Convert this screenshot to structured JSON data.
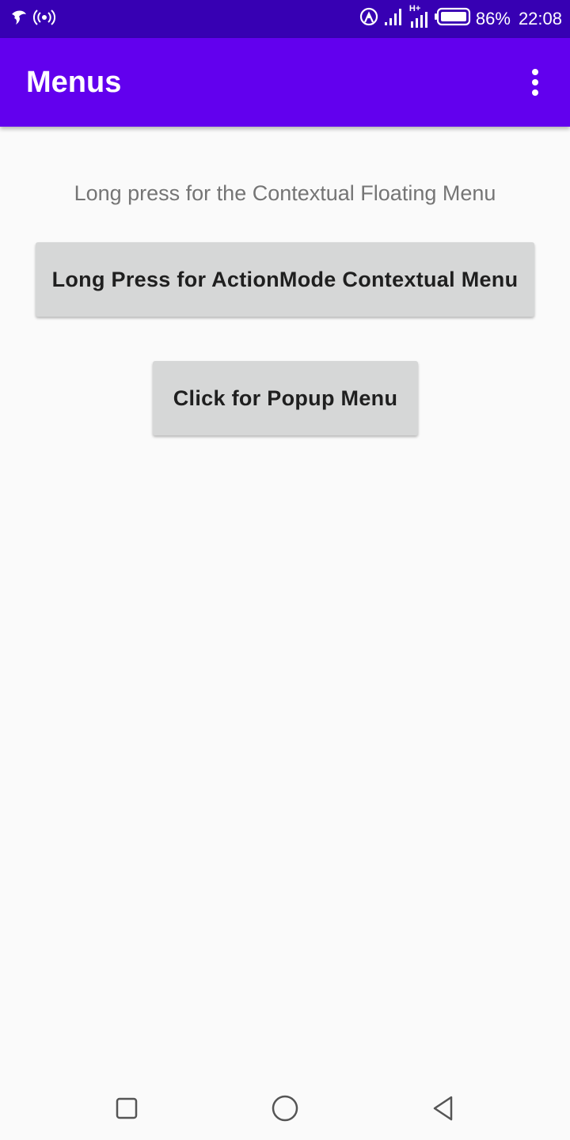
{
  "status_bar": {
    "icons_left": [
      "hummingbird-notification-icon",
      "hotspot-broadcast-icon"
    ],
    "icons_right": [
      "wireless-location-icon",
      "signal-icon",
      "hplus-signal-icon",
      "battery-icon"
    ],
    "network_label": "H+",
    "battery_percent": "86%",
    "time": "22:08"
  },
  "app_bar": {
    "title": "Menus",
    "overflow_icon": "more-vert-icon"
  },
  "main": {
    "hint": "Long press for the Contextual Floating Menu",
    "action_mode_button": "Long Press for ActionMode Contextual Menu",
    "popup_button": "Click for Popup Menu"
  },
  "nav_bar": {
    "icons": [
      "recents-square-icon",
      "home-circle-icon",
      "back-triangle-icon"
    ]
  },
  "colors": {
    "status_bar": "#3700b3",
    "app_bar": "#6200ee",
    "background": "#fafafa",
    "button": "#d6d7d7"
  }
}
